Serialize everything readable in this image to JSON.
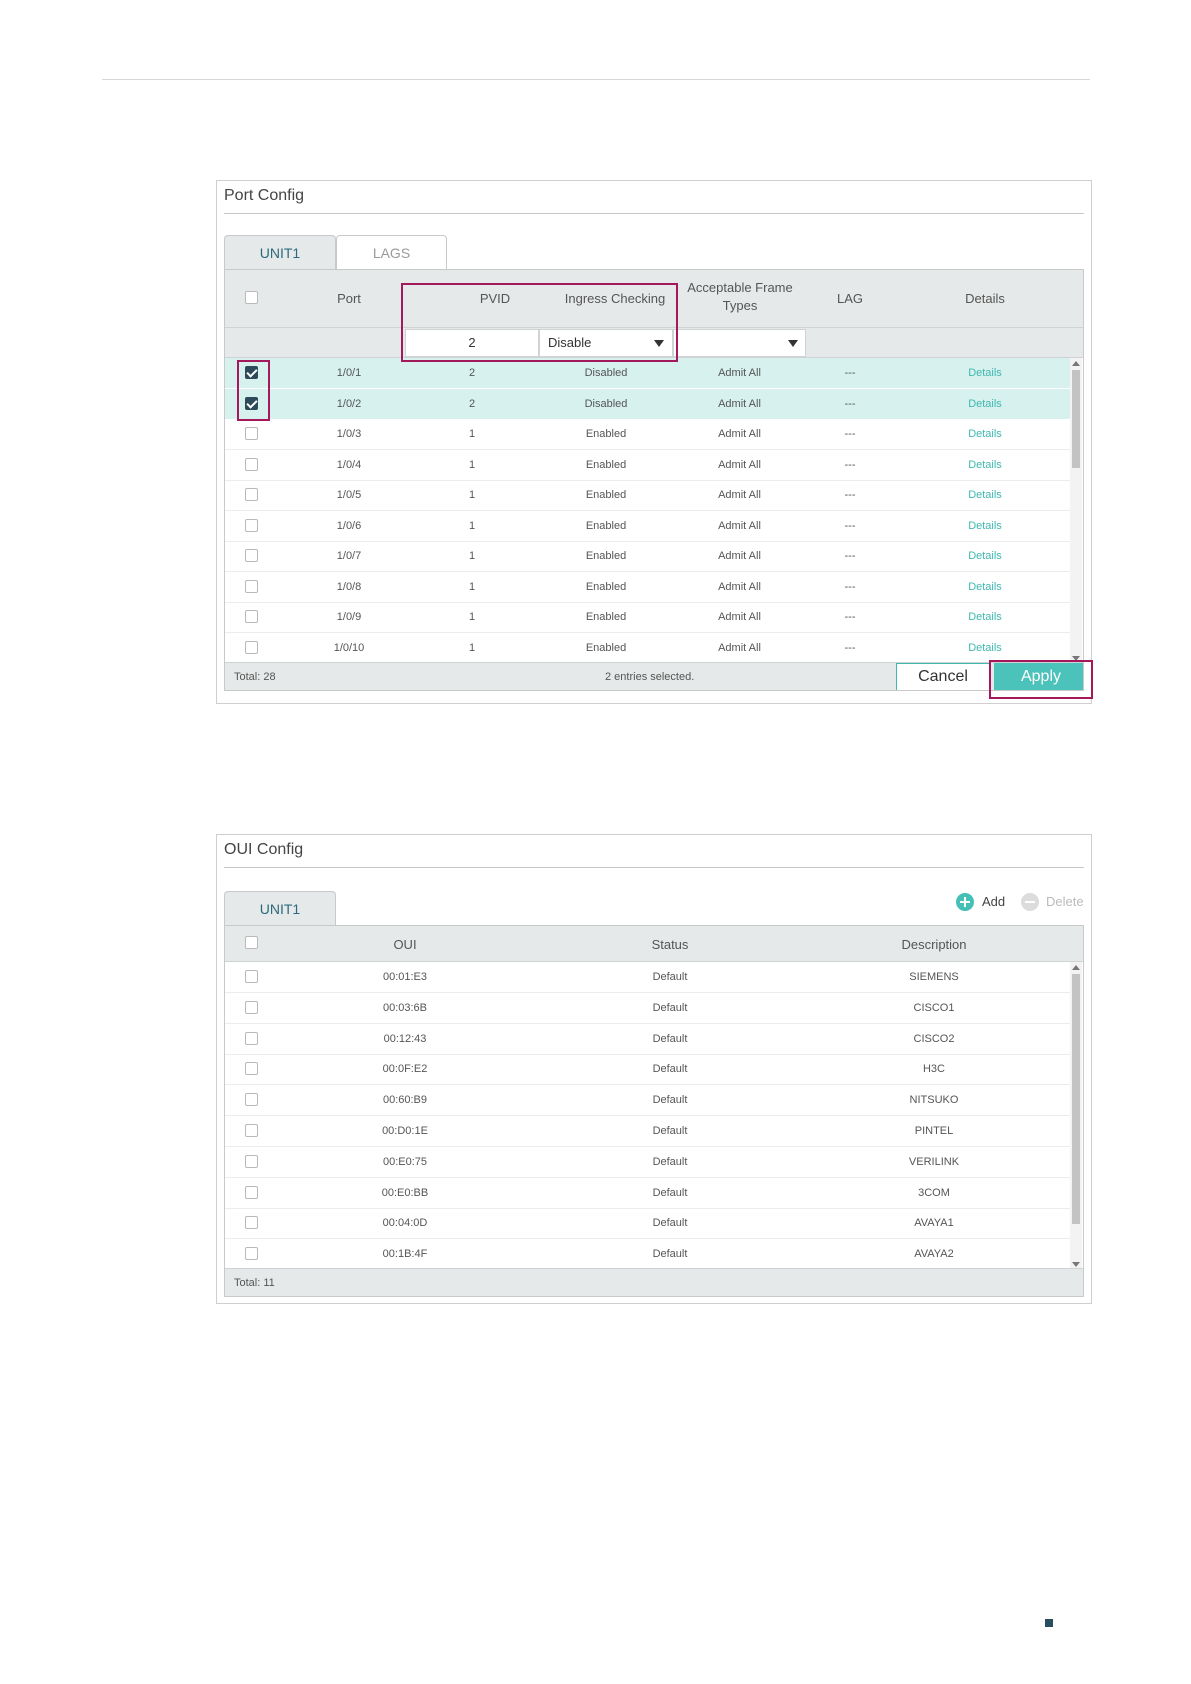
{
  "port_config": {
    "title": "Port Config",
    "tabs": [
      "UNIT1",
      "LAGS"
    ],
    "active_tab": "UNIT1",
    "columns": {
      "port": "Port",
      "pvid": "PVID",
      "ingress": "Ingress Checking",
      "frame_types": "Acceptable Frame Types",
      "lag": "LAG",
      "details": "Details"
    },
    "edit_row": {
      "pvid": "2",
      "ingress": "Disable",
      "frame_types": ""
    },
    "rows": [
      {
        "port": "1/0/1",
        "pvid": "2",
        "ingress": "Disabled",
        "frame": "Admit All",
        "lag": "---",
        "details": "Details",
        "checked": true
      },
      {
        "port": "1/0/2",
        "pvid": "2",
        "ingress": "Disabled",
        "frame": "Admit All",
        "lag": "---",
        "details": "Details",
        "checked": true
      },
      {
        "port": "1/0/3",
        "pvid": "1",
        "ingress": "Enabled",
        "frame": "Admit All",
        "lag": "---",
        "details": "Details",
        "checked": false
      },
      {
        "port": "1/0/4",
        "pvid": "1",
        "ingress": "Enabled",
        "frame": "Admit All",
        "lag": "---",
        "details": "Details",
        "checked": false
      },
      {
        "port": "1/0/5",
        "pvid": "1",
        "ingress": "Enabled",
        "frame": "Admit All",
        "lag": "---",
        "details": "Details",
        "checked": false
      },
      {
        "port": "1/0/6",
        "pvid": "1",
        "ingress": "Enabled",
        "frame": "Admit All",
        "lag": "---",
        "details": "Details",
        "checked": false
      },
      {
        "port": "1/0/7",
        "pvid": "1",
        "ingress": "Enabled",
        "frame": "Admit All",
        "lag": "---",
        "details": "Details",
        "checked": false
      },
      {
        "port": "1/0/8",
        "pvid": "1",
        "ingress": "Enabled",
        "frame": "Admit All",
        "lag": "---",
        "details": "Details",
        "checked": false
      },
      {
        "port": "1/0/9",
        "pvid": "1",
        "ingress": "Enabled",
        "frame": "Admit All",
        "lag": "---",
        "details": "Details",
        "checked": false
      },
      {
        "port": "1/0/10",
        "pvid": "1",
        "ingress": "Enabled",
        "frame": "Admit All",
        "lag": "---",
        "details": "Details",
        "checked": false
      }
    ],
    "total": "Total: 28",
    "selected": "2 entries selected.",
    "cancel": "Cancel",
    "apply": "Apply"
  },
  "oui_config": {
    "title": "OUI Config",
    "tab": "UNIT1",
    "add": "Add",
    "delete": "Delete",
    "columns": {
      "oui": "OUI",
      "status": "Status",
      "description": "Description"
    },
    "rows": [
      {
        "oui": "00:01:E3",
        "status": "Default",
        "description": "SIEMENS"
      },
      {
        "oui": "00:03:6B",
        "status": "Default",
        "description": "CISCO1"
      },
      {
        "oui": "00:12:43",
        "status": "Default",
        "description": "CISCO2"
      },
      {
        "oui": "00:0F:E2",
        "status": "Default",
        "description": "H3C"
      },
      {
        "oui": "00:60:B9",
        "status": "Default",
        "description": "NITSUKO"
      },
      {
        "oui": "00:D0:1E",
        "status": "Default",
        "description": "PINTEL"
      },
      {
        "oui": "00:E0:75",
        "status": "Default",
        "description": "VERILINK"
      },
      {
        "oui": "00:E0:BB",
        "status": "Default",
        "description": "3COM"
      },
      {
        "oui": "00:04:0D",
        "status": "Default",
        "description": "AVAYA1"
      },
      {
        "oui": "00:1B:4F",
        "status": "Default",
        "description": "AVAYA2"
      }
    ],
    "total": "Total: 11"
  },
  "colors": {
    "accent": "#3fb8b0",
    "highlight": "#a3195b",
    "selected_row": "#d6f1ee",
    "header_bg": "#e6e9e9"
  }
}
